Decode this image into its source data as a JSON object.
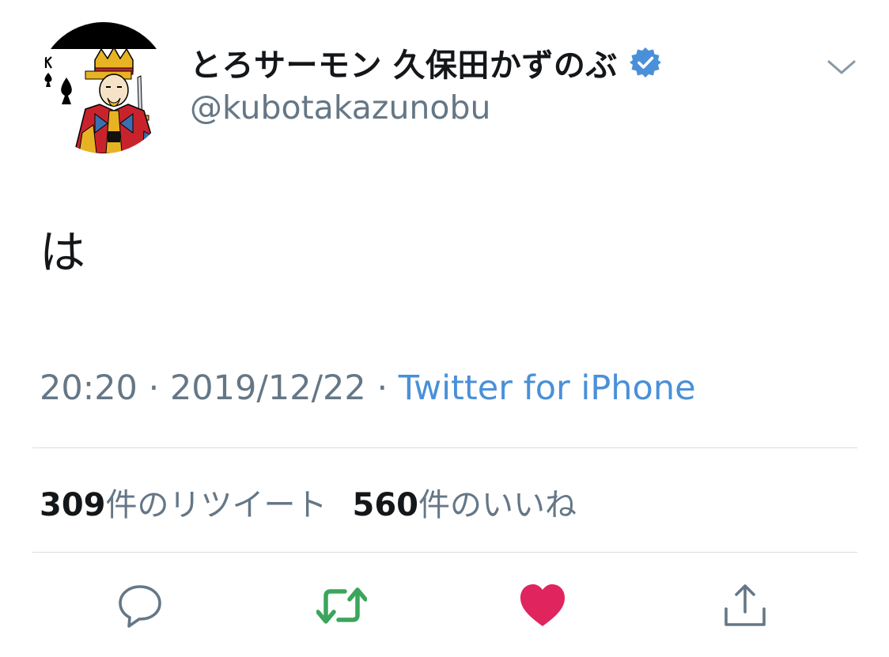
{
  "tweet": {
    "display_name": "とろサーモン 久保田かずのぶ",
    "handle": "@kubotakazunobu",
    "verified": true,
    "text": "は",
    "time": "20:20",
    "date": "2019/12/22",
    "separator": "·",
    "source": "Twitter for iPhone"
  },
  "stats": {
    "retweets_count": "309",
    "retweets_label": "件のリツイート",
    "likes_count": "560",
    "likes_label": "件のいいね"
  },
  "icons": {
    "avatar": "king-of-spades-card",
    "verified": "verified-badge-icon",
    "menu": "chevron-down-icon",
    "reply": "reply-icon",
    "retweet": "retweet-icon",
    "like": "heart-icon",
    "share": "share-icon"
  },
  "colors": {
    "verified": "#4a90d9",
    "link": "#4a90d9",
    "retweet_active": "#3ba55c",
    "like_active": "#e0245e",
    "secondary_text": "#657786"
  }
}
